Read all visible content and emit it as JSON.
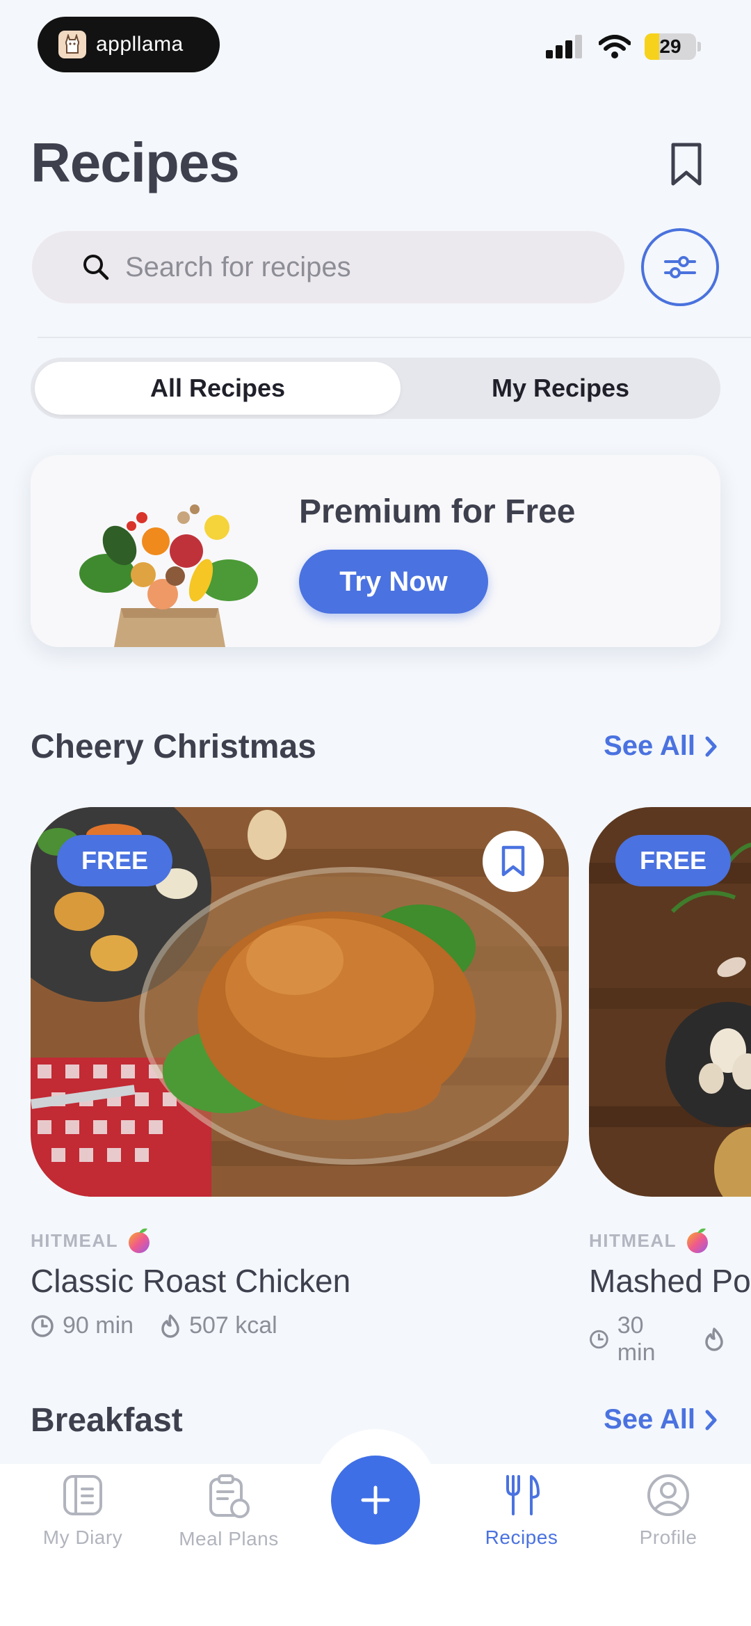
{
  "status_bar": {
    "app_name": "appllama",
    "battery_level": "29",
    "battery_fraction": 0.29,
    "icons": [
      "signal-icon",
      "wifi-icon",
      "battery-icon"
    ]
  },
  "header": {
    "title": "Recipes"
  },
  "search": {
    "placeholder": "Search for recipes",
    "value": ""
  },
  "tabs": [
    {
      "label": "All Recipes",
      "selected": true
    },
    {
      "label": "My Recipes",
      "selected": false
    }
  ],
  "promo": {
    "title": "Premium for Free",
    "button_label": "Try Now"
  },
  "sections": [
    {
      "title": "Cheery Christmas",
      "see_all_label": "See All",
      "recipes": [
        {
          "badge": "FREE",
          "source": "HITMEAL",
          "title": "Classic Roast Chicken",
          "time": "90 min",
          "calories": "507 kcal",
          "bookmarked": false
        },
        {
          "badge": "FREE",
          "source": "HITMEAL",
          "title": "Mashed Po",
          "time": "30 min",
          "calories": ""
        }
      ]
    },
    {
      "title": "Breakfast",
      "see_all_label": "See All"
    }
  ],
  "bottom_nav": {
    "items": [
      {
        "label": "My Diary",
        "icon": "diary-icon",
        "active": false
      },
      {
        "label": "Meal Plans",
        "icon": "meal-plans-icon",
        "active": false
      },
      {
        "label": "",
        "icon": "plus-icon",
        "active": false
      },
      {
        "label": "Recipes",
        "icon": "fork-knife-icon",
        "active": true
      },
      {
        "label": "Profile",
        "icon": "profile-icon",
        "active": false
      }
    ]
  },
  "colors": {
    "accent": "#4a72e0",
    "background": "#f4f7fb",
    "title_text": "#3e404e",
    "muted_text": "#8b8e98"
  }
}
